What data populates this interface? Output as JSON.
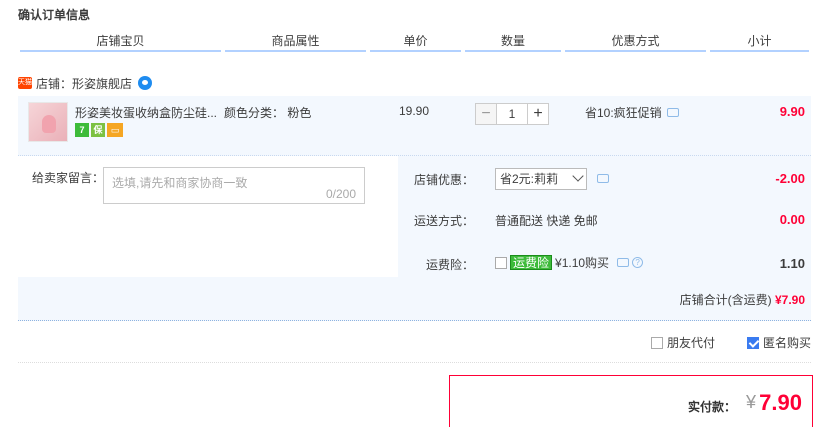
{
  "page": {
    "title": "确认订单信息"
  },
  "columns": [
    "店铺宝贝",
    "商品属性",
    "单价",
    "数量",
    "优惠方式",
    "小计"
  ],
  "shop": {
    "label": "店铺：",
    "name": "形姿旗舰店"
  },
  "item": {
    "name": "形姿美妆蛋收纳盒防尘硅...",
    "attr_label": "颜色分类：",
    "attr_value": "粉色",
    "price": "19.90",
    "quantity": "1",
    "promo": "省10:疯狂促销",
    "subtotal": "9.90",
    "tags": [
      "7",
      "保",
      "card"
    ]
  },
  "message": {
    "label": "给卖家留言：",
    "placeholder": "选填,请先和商家协商一致",
    "counter": "0/200"
  },
  "shop_discount": {
    "label": "店铺优惠：",
    "selected": "省2元:莉莉",
    "amount": "-2.00"
  },
  "shipping": {
    "label": "运送方式：",
    "value": "普通配送 快递 免邮",
    "amount": "0.00"
  },
  "insurance": {
    "label": "运费险：",
    "tag": "运费险",
    "price": "¥1.10购买",
    "amount": "1.10"
  },
  "shop_total": {
    "label": "店铺合计(含运费)",
    "amount": "¥7.90"
  },
  "extras": {
    "friend_pay": "朋友代付",
    "anonymous": "匿名购买"
  },
  "payment": {
    "label": "实付款：",
    "currency": "¥",
    "amount": "7.90"
  },
  "colors": {
    "price_red": "#ff0036",
    "row_bg": "#f3f8fe",
    "header_bar": "#b2d1ff"
  }
}
